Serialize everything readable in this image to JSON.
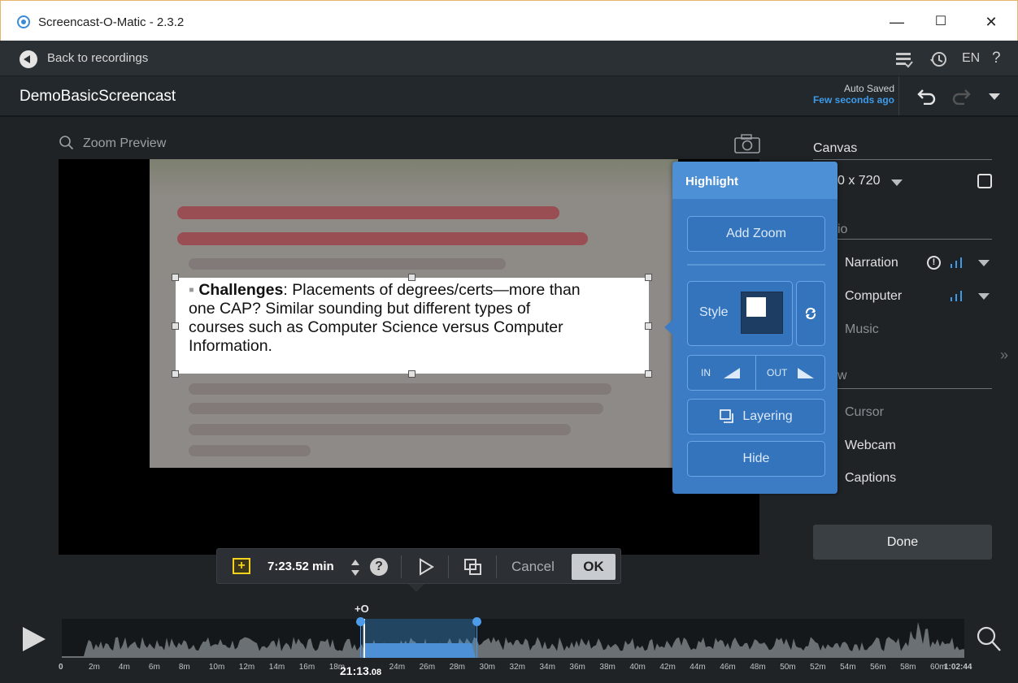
{
  "window": {
    "title": "Screencast-O-Matic - 2.3.2",
    "minimize": "—",
    "maximize": "☐",
    "close": "✕"
  },
  "topbar": {
    "back_label": "Back to recordings",
    "lang": "EN",
    "help": "?"
  },
  "project": {
    "name": "DemoBasicScreencast",
    "auto_saved": "Auto Saved",
    "saved_time": "Few seconds ago"
  },
  "preview": {
    "zoom_label": "Zoom Preview",
    "highlight_lines": [
      {
        "bold": "Challenges",
        "rest": ": Placements of degrees/certs—more than"
      },
      {
        "bold": "",
        "rest": "one CAP? Similar sounding but different types of"
      },
      {
        "bold": "",
        "rest": "courses such as Computer Science versus Computer"
      },
      {
        "bold": "",
        "rest": "Information."
      }
    ]
  },
  "highlight_panel": {
    "title": "Highlight",
    "add_zoom": "Add Zoom",
    "style": "Style",
    "in": "IN",
    "out": "OUT",
    "layering": "Layering",
    "hide": "Hide"
  },
  "canvas_panel": {
    "canvas_label": "Canvas",
    "size": "0 x 720",
    "audio_label": "io",
    "narration": "Narration",
    "computer": "Computer",
    "music": "Music",
    "view_label": "w",
    "cursor": "Cursor",
    "webcam": "Webcam",
    "captions": "Captions",
    "done": "Done"
  },
  "toolbar": {
    "duration": "7:23.52 min",
    "help": "?",
    "cancel": "Cancel",
    "ok": "OK"
  },
  "timeline": {
    "add_marker": "+O",
    "current_time": "21:13",
    "current_frac": ".08",
    "ticks": [
      "0",
      "2m",
      "4m",
      "6m",
      "8m",
      "10m",
      "12m",
      "14m",
      "16m",
      "18m",
      "",
      "24m",
      "26m",
      "28m",
      "30m",
      "32m",
      "34m",
      "36m",
      "38m",
      "40m",
      "42m",
      "44m",
      "46m",
      "48m",
      "50m",
      "52m",
      "54m",
      "56m",
      "58m",
      "60m",
      "1:02:44"
    ]
  },
  "colors": {
    "accent": "#3b7cc4",
    "link": "#3d9be9",
    "bg": "#1f2326"
  }
}
